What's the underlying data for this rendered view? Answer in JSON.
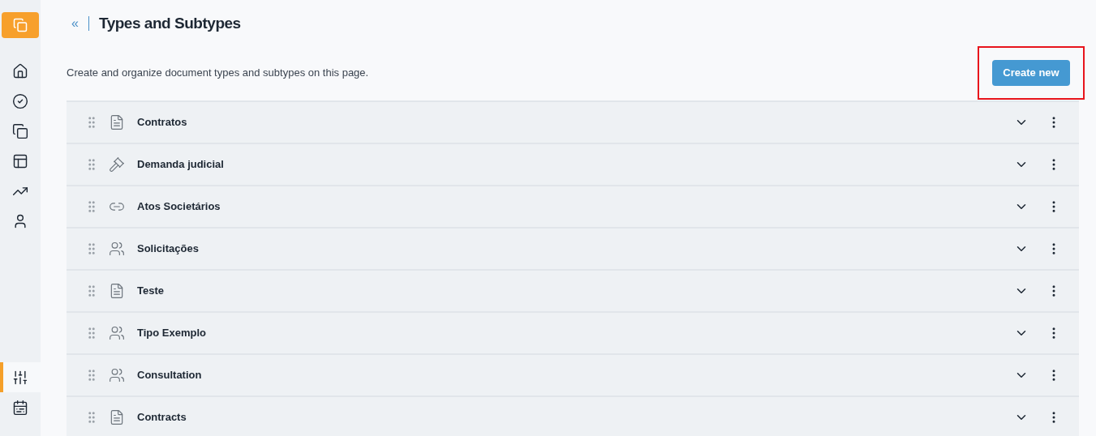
{
  "sidebar": {
    "items": [
      {
        "kind": "home",
        "selected": false
      },
      {
        "kind": "check",
        "selected": false
      },
      {
        "kind": "copy",
        "selected": false
      },
      {
        "kind": "board",
        "selected": false
      },
      {
        "kind": "chart",
        "selected": false
      },
      {
        "kind": "user",
        "selected": false
      }
    ],
    "bottom_items": [
      {
        "kind": "sliders",
        "selected": true
      },
      {
        "kind": "calendar",
        "selected": false
      }
    ]
  },
  "header": {
    "back": "«",
    "title": "Types and Subtypes"
  },
  "description": "Create and organize document types and subtypes on this page.",
  "create_button": {
    "label": "Create new",
    "highlighted": true
  },
  "types": [
    {
      "name": "Contratos",
      "kind": "document"
    },
    {
      "name": "Demanda judicial",
      "kind": "gavel"
    },
    {
      "name": "Atos Societários",
      "kind": "link"
    },
    {
      "name": "Solicitações",
      "kind": "people"
    },
    {
      "name": "Teste",
      "kind": "document"
    },
    {
      "name": "Tipo Exemplo",
      "kind": "people"
    },
    {
      "name": "Consultation",
      "kind": "people"
    },
    {
      "name": "Contracts",
      "kind": "document"
    }
  ]
}
